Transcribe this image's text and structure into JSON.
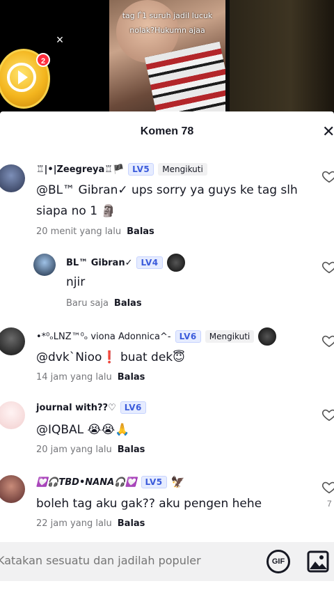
{
  "video": {
    "caption_line1": "tag Ѓ1 suruh jadiI Iucuk",
    "caption_line2": "nolak?Hukumn ajaa",
    "close_symbol": "×",
    "gift_badge_count": "2"
  },
  "sheet": {
    "title": "Komen 78",
    "close_symbol": "✕"
  },
  "comments": [
    {
      "username": "♖|•|Zeegreya♖🏴",
      "level": "LV5",
      "follow_label": "Mengikuti",
      "text_line1": "@BL™ Gibran✓  ups sorry ya guys ke tag slh",
      "text_line2": "siapa no 1 🗿",
      "time": "20 menit yang lalu",
      "reply_label": "Balas"
    },
    {
      "username": "BL™ Gibran✓",
      "level": "LV4",
      "text_line1": "njir",
      "time": "Baru saja",
      "reply_label": "Balas"
    },
    {
      "username": "•*⁰ₒLNZ™⁰ₒ viona Adonnica^-",
      "level": "LV6",
      "follow_label": "Mengikuti",
      "text_line1": "@dvk`Nioo❗ buat dek😇",
      "time": "14 jam yang lalu",
      "reply_label": "Balas"
    },
    {
      "username": "journal with??♡",
      "level": "LV6",
      "text_line1": "@IQBAL 😭😭🙏",
      "time": "20 jam yang lalu",
      "reply_label": "Balas"
    },
    {
      "username": "💟🎧TBD•NANA🎧💟",
      "level": "LV5",
      "text_line1": "boleh tag aku gak?? aku pengen hehe",
      "time": "22 jam yang lalu",
      "reply_label": "Balas",
      "like_count": "7"
    }
  ],
  "input": {
    "placeholder": "Katakan sesuatu dan jadilah populer",
    "gif_label": "GIF"
  },
  "colors": {
    "level_badge_text": "#3b5bdb",
    "level_badge_bg": "#e6ecff",
    "coin_gold": "#f3b51e",
    "badge_red": "#ff2d3d"
  }
}
